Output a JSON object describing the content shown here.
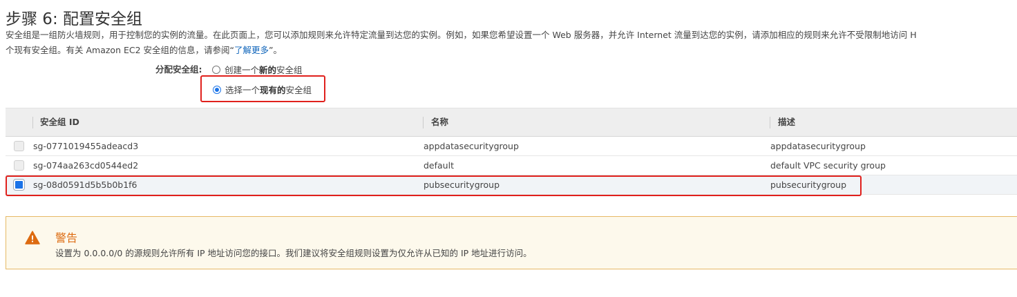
{
  "header": {
    "title": "步骤 6: 配置安全组"
  },
  "description": {
    "line1": "安全组是一组防火墙规则，用于控制您的实例的流量。在此页面上，您可以添加规则来允许特定流量到达您的实例。例如，如果您希望设置一个 Web 服务器，并允许 Internet 流量到达您的实例，请添加相应的规则来允许不受限制地访问 H",
    "line2_prefix": "个现有安全组。有关 Amazon EC2 安全组的信息，请参阅“",
    "link_text": "了解更多",
    "line2_suffix": "”。"
  },
  "assign": {
    "label": "分配安全组:",
    "option_new": {
      "prefix": "创建一个",
      "bold": "新的",
      "suffix": "安全组",
      "selected": false
    },
    "option_existing": {
      "prefix": "选择一个",
      "bold": "现有的",
      "suffix": "安全组",
      "selected": true
    }
  },
  "table": {
    "columns": [
      "安全组 ID",
      "名称",
      "描述"
    ],
    "rows": [
      {
        "id": "sg-0771019455adeacd3",
        "name": "appdatasecuritygroup",
        "description": "appdatasecuritygroup",
        "selected": false
      },
      {
        "id": "sg-074aa263cd0544ed2",
        "name": "default",
        "description": "default VPC security group",
        "selected": false
      },
      {
        "id": "sg-08d0591d5b5b0b1f6",
        "name": "pubsecuritygroup",
        "description": "pubsecuritygroup",
        "selected": true
      }
    ]
  },
  "warning": {
    "icon": "warning-triangle-icon",
    "title": "警告",
    "text": "设置为 0.0.0.0/0 的源规则允许所有 IP 地址访问您的接口。我们建议将安全组规则设置为仅允许从已知的 IP 地址进行访问。"
  },
  "colors": {
    "highlight": "#e0201c",
    "accent": "#1a73e8",
    "warning_orange": "#dd6b10"
  }
}
